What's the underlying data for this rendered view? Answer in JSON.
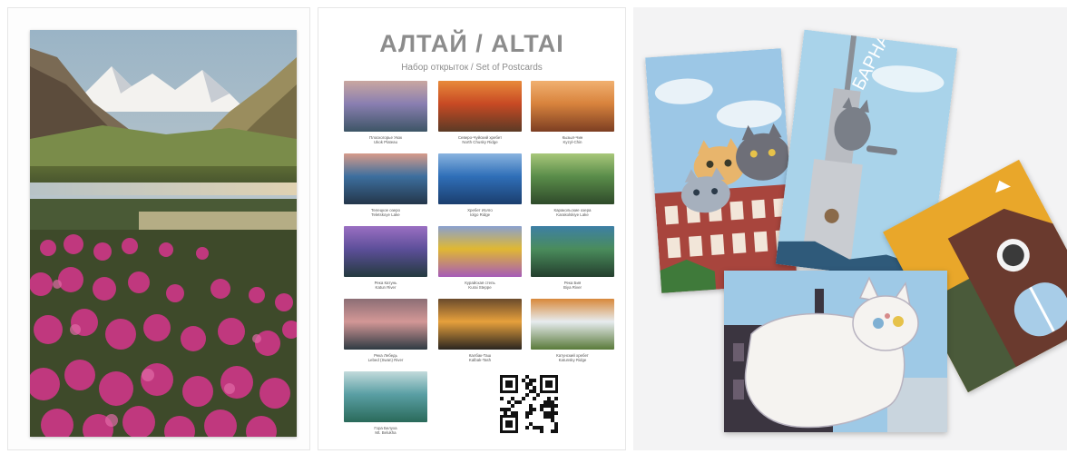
{
  "set": {
    "title": "АЛТАЙ / ALTAI",
    "subtitle": "Набор открыток / Set of Postcards"
  },
  "postcards": [
    {
      "ru": "Плоскогорье Укок",
      "en": "Ukok Plateau",
      "colors": [
        "#8a7fb1",
        "#c9a7a0",
        "#3d5566"
      ]
    },
    {
      "ru": "Северо-Чуйский хребет",
      "en": "North Chusky Ridge",
      "colors": [
        "#c84a24",
        "#e88a3a",
        "#5b3a25"
      ]
    },
    {
      "ru": "Кызыл-Чин",
      "en": "Kyzyl-Chin",
      "colors": [
        "#d8833d",
        "#f1b070",
        "#7c3e22"
      ]
    },
    {
      "ru": "Телецкое озеро",
      "en": "Teletskoye Lake",
      "colors": [
        "#3d6f9e",
        "#d79b8a",
        "#24364a"
      ]
    },
    {
      "ru": "Хребет Иолго",
      "en": "Iolgo Ridge",
      "colors": [
        "#2f6fb8",
        "#89b3df",
        "#1b3e6e"
      ]
    },
    {
      "ru": "Каракольские озера",
      "en": "Karakolskiye Lake",
      "colors": [
        "#5a8d4a",
        "#a8c77a",
        "#2f4a2a"
      ]
    },
    {
      "ru": "Река Катунь",
      "en": "Katun River",
      "colors": [
        "#5d4f9a",
        "#9a6fc2",
        "#243a3f"
      ]
    },
    {
      "ru": "Курайская степь",
      "en": "Kurai Steppe",
      "colors": [
        "#e0b832",
        "#8aa0cf",
        "#a65bb8"
      ]
    },
    {
      "ru": "Река Бия",
      "en": "Biya River",
      "colors": [
        "#4a8c5c",
        "#3d7fa5",
        "#243f2e"
      ]
    },
    {
      "ru": "Река Лебедь",
      "en": "Lebed (Swan) River",
      "colors": [
        "#d39796",
        "#8c6e75",
        "#2f3a43"
      ]
    },
    {
      "ru": "Калбак-Таш",
      "en": "Kalbak-Tash",
      "colors": [
        "#e6a03c",
        "#6a4b2c",
        "#2a2520"
      ]
    },
    {
      "ru": "Катунский хребет",
      "en": "Katunsky Ridge",
      "colors": [
        "#e7ecef",
        "#d8883a",
        "#5a7a3a"
      ]
    },
    {
      "ru": "Гора Белуха",
      "en": "Mt. Belukha",
      "colors": [
        "#5a9fa4",
        "#c2dadb",
        "#2a6a5a"
      ]
    }
  ],
  "cat_card": {
    "sign": "БАРНАУЛ!"
  },
  "colors": {
    "sky": "#9cc7e6",
    "flowers": "#c0387e",
    "grass": "#4f6a36",
    "building_red": "#a8453d",
    "accent_yellow": "#e9a72a"
  }
}
